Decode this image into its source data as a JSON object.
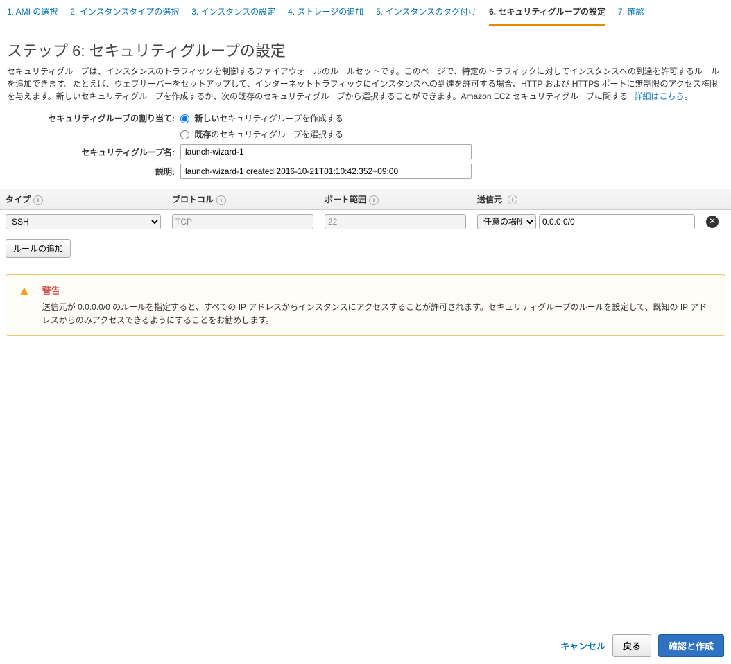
{
  "nav": {
    "steps": [
      "1. AMI の選択",
      "2. インスタンスタイプの選択",
      "3. インスタンスの設定",
      "4. ストレージの追加",
      "5. インスタンスのタグ付け",
      "6. セキュリティグループの設定",
      "7. 確認"
    ],
    "active_index": 5
  },
  "page": {
    "title": "ステップ 6: セキュリティグループの設定",
    "description": "セキュリティグループは、インスタンスのトラフィックを制御するファイアウォールのルールセットです。このページで、特定のトラフィックに対してインスタンスへの到達を許可するルールを追加できます。たとえば、ウェブサーバーをセットアップして、インターネットトラフィックにインスタンスへの到達を許可する場合、HTTP および HTTPS ポートに無制限のアクセス権限を与えます。新しいセキュリティグループを作成するか、次の既存のセキュリティグループから選択することができます。Amazon EC2 セキュリティグループに関する",
    "learn_more": "詳細はこちら",
    "period": "。"
  },
  "form": {
    "assign_label": "セキュリティグループの割り当て:",
    "radio_new_bold": "新しい",
    "radio_new_rest": "セキュリティグループを作成する",
    "radio_existing_bold": "既存",
    "radio_existing_rest": "のセキュリティグループを選択する",
    "name_label": "セキュリティグループ名:",
    "name_value": "launch-wizard-1",
    "desc_label": "説明:",
    "desc_value": "launch-wizard-1 created 2016-10-21T01:10:42.352+09:00"
  },
  "table": {
    "headers": {
      "type": "タイプ",
      "protocol": "プロトコル",
      "port": "ポート範囲",
      "source": "送信元"
    },
    "row": {
      "type": "SSH",
      "protocol": "TCP",
      "port": "22",
      "source_select": "任意の場所",
      "source_cidr": "0.0.0.0/0"
    },
    "add_rule": "ルールの追加"
  },
  "warning": {
    "title": "警告",
    "text": "送信元が 0.0.0.0/0 のルールを指定すると、すべての IP アドレスからインスタンスにアクセスすることが許可されます。セキュリティグループのルールを設定して、既知の IP アドレスからのみアクセスできるようにすることをお勧めします。"
  },
  "footer": {
    "cancel": "キャンセル",
    "back": "戻る",
    "review": "確認と作成"
  }
}
